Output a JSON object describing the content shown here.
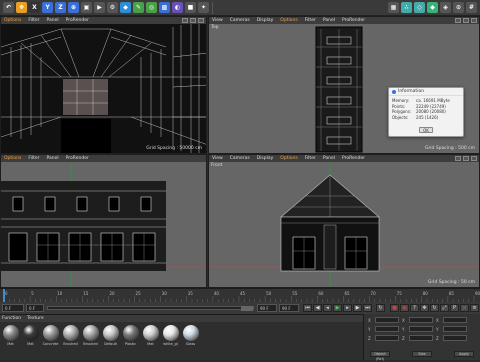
{
  "colors": {
    "accent": "#f0a040",
    "bg": "#2b2b2b",
    "viewport": "#666666",
    "dialog": "#f2f2f2"
  },
  "toolbar": {
    "buttons": [
      {
        "name": "undo-icon",
        "glyph": "↶",
        "bg": "#555"
      },
      {
        "name": "move-tool-icon",
        "glyph": "✥",
        "bg": "#e9a020"
      },
      {
        "name": "close-x-icon",
        "glyph": "X",
        "bg": "#333"
      },
      {
        "name": "axis-y-icon",
        "glyph": "Y",
        "bg": "#3a6fd8"
      },
      {
        "name": "axis-z-icon",
        "glyph": "Z",
        "bg": "#3a6fd8"
      },
      {
        "name": "coord-system-icon",
        "glyph": "⊕",
        "bg": "#3a6fd8"
      },
      {
        "name": "render-view-icon",
        "glyph": "▣",
        "bg": "#555"
      },
      {
        "name": "render-picture-icon",
        "glyph": "▶",
        "bg": "#555"
      },
      {
        "name": "render-settings-icon",
        "glyph": "⚙",
        "bg": "#555"
      },
      {
        "name": "cube-primitive-icon",
        "glyph": "◆",
        "bg": "#2a8fd8"
      },
      {
        "name": "pen-spline-icon",
        "glyph": "✎",
        "bg": "#4a9f4a"
      },
      {
        "name": "generator-icon",
        "glyph": "◎",
        "bg": "#4a9f4a"
      },
      {
        "name": "deformer-icon",
        "glyph": "▩",
        "bg": "#3a6fd8"
      },
      {
        "name": "environment-icon",
        "glyph": "◐",
        "bg": "#6a4fb8"
      },
      {
        "name": "camera-icon",
        "glyph": "■",
        "bg": "#555"
      },
      {
        "name": "light-icon",
        "glyph": "✦",
        "bg": "#555"
      }
    ],
    "right_buttons": [
      {
        "name": "edit-mode-icon",
        "glyph": "▦",
        "bg": "#555"
      },
      {
        "name": "points-mode-icon",
        "glyph": "∴",
        "bg": "#4aa"
      },
      {
        "name": "edges-mode-icon",
        "glyph": "◇",
        "bg": "#4aa"
      },
      {
        "name": "polygons-mode-icon",
        "glyph": "◆",
        "bg": "#3ab07a"
      },
      {
        "name": "uv-mode-icon",
        "glyph": "◈",
        "bg": "#555"
      },
      {
        "name": "snap-icon",
        "glyph": "⊙",
        "bg": "#555"
      },
      {
        "name": "workplane-icon",
        "glyph": "#",
        "bg": "#555"
      }
    ]
  },
  "viewports": {
    "perspective": {
      "menu": [
        "Options",
        "Filter",
        "Panel",
        "ProRender"
      ],
      "active_index": 0,
      "grid": "Grid Spacing : 50000 cm"
    },
    "top": {
      "menu": [
        "View",
        "Cameras",
        "Display",
        "Options",
        "Filter",
        "Panel",
        "ProRender"
      ],
      "active_index": 3,
      "label": "Top",
      "grid": "Grid Spacing : 500 cm"
    },
    "right": {
      "menu": [
        "Options",
        "Filter",
        "Panel",
        "ProRender"
      ],
      "active_index": 0,
      "grid": "Grid Spacing : 500 cm"
    },
    "front": {
      "menu": [
        "View",
        "Cameras",
        "Display",
        "Options",
        "Filter",
        "Panel",
        "ProRender"
      ],
      "active_index": 3,
      "label": "Front",
      "grid": "Grid Spacing : 50 cm"
    }
  },
  "info_dialog": {
    "title": "Information",
    "rows": [
      {
        "key": "Memory:",
        "value": "ca. 16691 MByte"
      },
      {
        "key": "Points:",
        "value": "22249 (22749)"
      },
      {
        "key": "Polygons:",
        "value": "20080 (20080)"
      },
      {
        "key": "Objects:",
        "value": "245 (1426)"
      }
    ],
    "ok": "OK"
  },
  "timeline": {
    "ticks": [
      "0",
      "5",
      "10",
      "15",
      "20",
      "25",
      "30",
      "35",
      "40",
      "45",
      "50",
      "55",
      "60",
      "65",
      "70",
      "75",
      "80",
      "85",
      "90"
    ]
  },
  "controls": {
    "start": "0 F",
    "current": "0 F",
    "end": "90 F",
    "end2": "90 F",
    "frame": "0 F"
  },
  "materials": {
    "menu": [
      "Function",
      "Texture"
    ],
    "items": [
      {
        "name": "Mat",
        "color": "#8a8a8a"
      },
      {
        "name": "Mat",
        "color": "#3a3a3a"
      },
      {
        "name": "Concrete",
        "color": "#9a9a9a"
      },
      {
        "name": "Brushed",
        "color": "#b0b0b0"
      },
      {
        "name": "Brushed",
        "color": "#a8a8a8"
      },
      {
        "name": "Default",
        "color": "#c8c8c8"
      },
      {
        "name": "Plastic",
        "color": "#7a7a7a"
      },
      {
        "name": "Mat",
        "color": "#d0d0d0"
      },
      {
        "name": "white_gl",
        "color": "#e6e6e6"
      },
      {
        "name": "Glass",
        "color": "#cfd8e4"
      }
    ]
  },
  "attributes": {
    "labels": [
      "X",
      "Y",
      "Z"
    ],
    "button1": "Object (Rel)",
    "button2": "Size",
    "button3": "Apply"
  }
}
